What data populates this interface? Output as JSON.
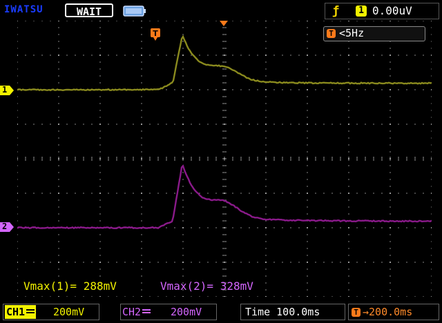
{
  "header": {
    "brand": "IWATSU",
    "status": "WAIT",
    "trigger_edge_icon": "rising-edge-icon",
    "trigger_source": "1",
    "trigger_level": "0.00uV"
  },
  "screen": {
    "frequency": "<5Hz",
    "trigger_marker": "T",
    "ch1_marker": "1",
    "ch2_marker": "2"
  },
  "measurements": {
    "ch1": "Vmax(1)= 288mV",
    "ch2": "Vmax(2)= 328mV"
  },
  "footer": {
    "ch1_label": "CH1",
    "ch1_scale": "200mV",
    "ch2_label": "CH2",
    "ch2_scale": "200mV",
    "time_label": "Time",
    "time_scale": "100.0ms",
    "trigger_badge": "T",
    "trigger_delay": "200.0ms"
  },
  "colors": {
    "ch1": "#f2f200",
    "ch1_trace": "#8a8a1e",
    "ch2": "#d466ff",
    "ch2_trace": "#8a1a8a",
    "trigger": "#ff7a1a",
    "brand": "#1a3cff"
  }
}
